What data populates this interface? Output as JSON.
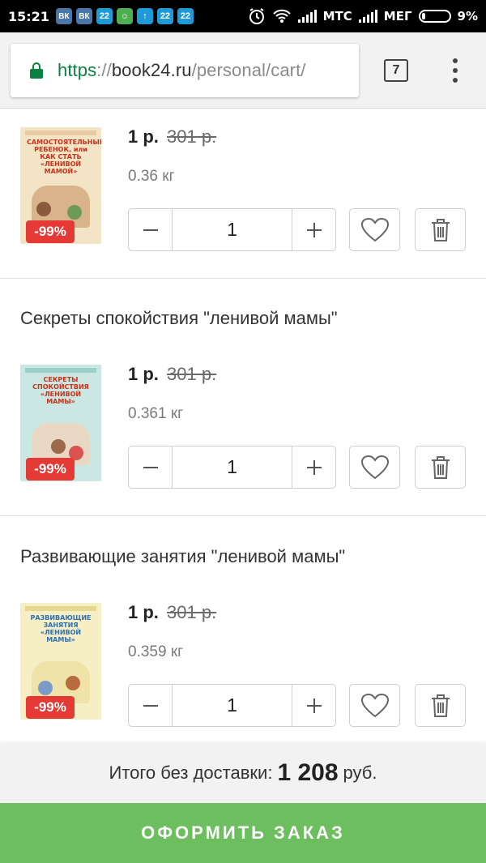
{
  "status_bar": {
    "time": "15:21",
    "notifications": [
      "ВК",
      "ВК",
      "22",
      "☺",
      "↑",
      "22",
      "22"
    ],
    "carrier1": "МТС",
    "carrier2": "МЕГ",
    "battery": "9%"
  },
  "browser": {
    "url_scheme": "https",
    "url_sep": "://",
    "url_host": "book24.ru",
    "url_path": "/personal/cart/",
    "tabs_count": "7"
  },
  "cart": {
    "items": [
      {
        "title": "",
        "cover_text": "САМОСТОЯТЕЛЬНЫЙ РЕБЕНОК, или КАК СТАТЬ «ЛЕНИВОЙ МАМОЙ»",
        "cover_color": "#f4e4c6",
        "discount": "-99%",
        "price": "1 р.",
        "old_price": "301 р.",
        "weight": "0.36 кг",
        "quantity": "1"
      },
      {
        "title": "Секреты спокойствия \"ленивой мамы\"",
        "cover_text": "СЕКРЕТЫ СПОКОЙСТВИЯ «ЛЕНИВОЙ МАМЫ»",
        "cover_color": "#cbe7e3",
        "discount": "-99%",
        "price": "1 р.",
        "old_price": "301 р.",
        "weight": "0.361 кг",
        "quantity": "1"
      },
      {
        "title": "Развивающие занятия \"ленивой мамы\"",
        "cover_text": "РАЗВИВАЮЩИЕ ЗАНЯТИЯ «ЛЕНИВОЙ МАМЫ»",
        "cover_color": "#f6efc5",
        "discount": "-99%",
        "price": "1 р.",
        "old_price": "301 р.",
        "weight": "0.359 кг",
        "quantity": "1"
      }
    ]
  },
  "summary": {
    "label": "Итого без доставки:",
    "amount": "1 208",
    "currency": "руб."
  },
  "checkout": {
    "label": "ОФОРМИТЬ ЗАКАЗ"
  },
  "colors": {
    "accent_green": "#6dbe5f",
    "discount_red": "#e53935",
    "secure_green": "#0b8043"
  }
}
